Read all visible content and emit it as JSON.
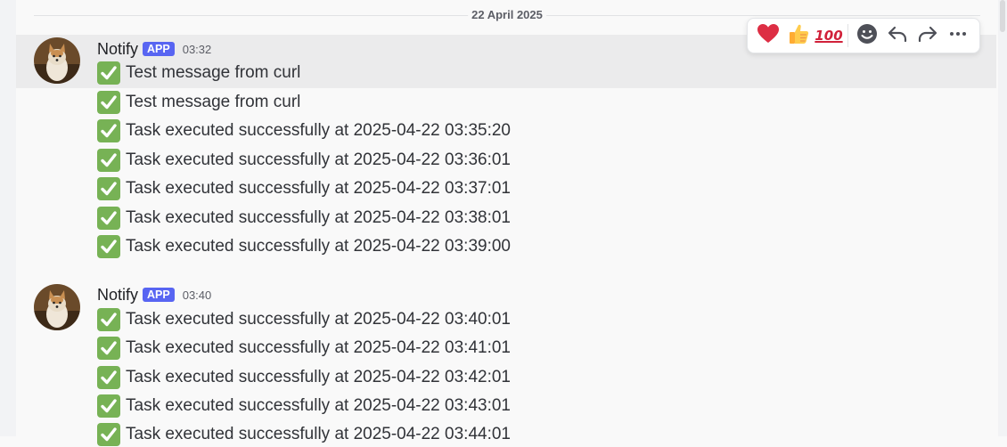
{
  "date_divider": "22 April 2025",
  "messages": [
    {
      "author": "Notify",
      "badge": "APP",
      "time": "03:32",
      "lines": [
        "Test message from curl",
        "Test message from curl",
        "Task executed successfully at 2025-04-22 03:35:20",
        "Task executed successfully at 2025-04-22 03:36:01",
        "Task executed successfully at 2025-04-22 03:37:01",
        "Task executed successfully at 2025-04-22 03:38:01",
        "Task executed successfully at 2025-04-22 03:39:00"
      ]
    },
    {
      "author": "Notify",
      "badge": "APP",
      "time": "03:40",
      "lines": [
        "Task executed successfully at 2025-04-22 03:40:01",
        "Task executed successfully at 2025-04-22 03:41:01",
        "Task executed successfully at 2025-04-22 03:42:01",
        "Task executed successfully at 2025-04-22 03:43:01",
        "Task executed successfully at 2025-04-22 03:44:01"
      ]
    }
  ],
  "toolbar": {
    "reactions": [
      "heart-icon",
      "thumbs-up-icon",
      "hundred-points-icon"
    ],
    "hundred_label": "100",
    "actions": [
      "add-reaction-icon",
      "reply-icon",
      "forward-icon",
      "more-icon"
    ]
  },
  "colors": {
    "badge": "#5865f2",
    "check": "#77b255",
    "hover": "#ebebec"
  }
}
